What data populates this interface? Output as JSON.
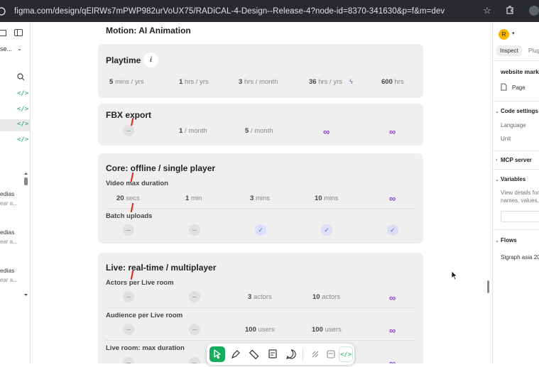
{
  "browser": {
    "url": "figma.com/design/qElRWs7mPWP982urVoUX75/RADiCAL-4-Design--Release-4?node-id=8370-341630&p=f&m=dev"
  },
  "left_panel": {
    "page_label": "se...",
    "items": [
      {
        "label": "edias",
        "sub": "ear a..."
      },
      {
        "label": "edias",
        "sub": "ear a..."
      },
      {
        "label": "edias",
        "sub": "ear a..."
      }
    ]
  },
  "main": {
    "section_title": "Motion: AI Animation",
    "playtime": {
      "title": "Playtime",
      "info": "i",
      "cells": [
        {
          "value": "5",
          "unit": "mins  / yrs"
        },
        {
          "value": "1",
          "unit": "hrs  / yrs"
        },
        {
          "value": "3",
          "unit": "hrs  / month"
        },
        {
          "value": "36",
          "unit": "hrs / yrs"
        },
        {
          "value": "600",
          "unit": "hrs"
        }
      ]
    },
    "fbx": {
      "title": "FBX export",
      "cells": [
        {
          "value": "1",
          "unit": "/ month"
        },
        {
          "value": "5",
          "unit": "/ month"
        }
      ],
      "infinity": "∞"
    },
    "core": {
      "title": "Core: offline / single player",
      "video_label": "Video max duration",
      "video_cells": [
        {
          "value": "20",
          "unit": "secs"
        },
        {
          "value": "1",
          "unit": "min"
        },
        {
          "value": "3",
          "unit": "mins"
        },
        {
          "value": "10",
          "unit": "mins"
        }
      ],
      "batch_label": "Batch uploads"
    },
    "live": {
      "title": "Live: real-time / multiplayer",
      "actors_label": "Actors per Live room",
      "actors_cells": [
        {
          "value": "3",
          "unit": "actors"
        },
        {
          "value": "10",
          "unit": "actors"
        }
      ],
      "audience_label": "Audience per Live room",
      "audience_cells": [
        {
          "value": "100",
          "unit": "users"
        },
        {
          "value": "100",
          "unit": "users"
        }
      ],
      "duration_label": "Live room: max duration"
    }
  },
  "right_panel": {
    "avatar": "R",
    "tabs": [
      "Inspect",
      "Plug"
    ],
    "selection": "website mark",
    "page": "Page",
    "code_settings": "Code settings",
    "language": "Language",
    "unit": "Unit",
    "mcp": "MCP server",
    "variables": "Variables",
    "variables_desc_1": "View details for",
    "variables_desc_2": "names, values, r",
    "flows": "Flows",
    "flows_item": "Sigraph asia 20"
  },
  "colors": {
    "card_bg": "#efefef",
    "infinity": "#8a3fd1",
    "check": "#5b64d9",
    "accent_green": "#18a058"
  }
}
